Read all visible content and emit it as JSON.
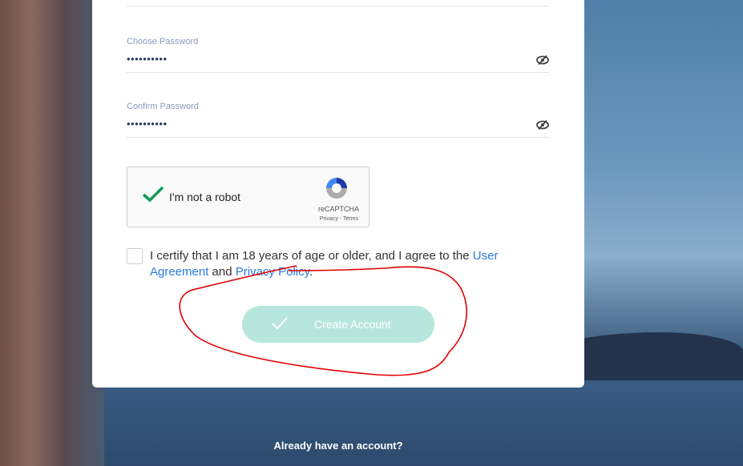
{
  "form": {
    "password": {
      "label": "Choose Password",
      "value": "••••••••••",
      "icon": "eye-slash-icon"
    },
    "confirm": {
      "label": "Confirm Password",
      "value": "••••••••••",
      "icon": "eye-slash-icon"
    },
    "recaptcha": {
      "label": "I'm not a robot",
      "brand": "reCAPTCHA",
      "privacy": "Privacy",
      "sep": " - ",
      "terms": "Terms",
      "checked": true
    },
    "agreement": {
      "text1": "I certify that I am 18 years of age or older, and I agree to the ",
      "link1": "User Agreement",
      "text2": " and ",
      "link2": "Privacy Policy",
      "text3": ".",
      "checked": false
    },
    "submit": {
      "label": "Create Account",
      "icon": "check-icon"
    }
  },
  "footer": {
    "login_prompt": "Already have an account?"
  },
  "colors": {
    "accent": "#b7e6dc",
    "link": "#2a7ae2",
    "annotation": "#e00000"
  }
}
